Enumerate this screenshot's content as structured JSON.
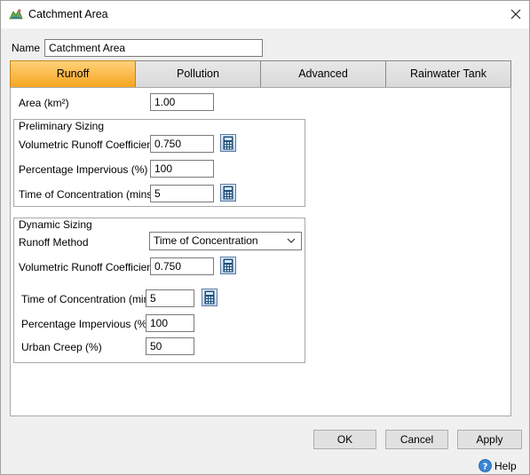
{
  "window": {
    "title": "Catchment Area"
  },
  "name_field": {
    "label": "Name",
    "value": "Catchment Area"
  },
  "tabs": [
    {
      "label": "Runoff",
      "active": true
    },
    {
      "label": "Pollution",
      "active": false
    },
    {
      "label": "Advanced",
      "active": false
    },
    {
      "label": "Rainwater Tank",
      "active": false
    }
  ],
  "runoff": {
    "area": {
      "label": "Area (km²)",
      "value": "1.00"
    },
    "preliminary": {
      "title": "Preliminary Sizing",
      "vrc": {
        "label": "Volumetric Runoff Coefficient",
        "value": "0.750"
      },
      "pct_impervious": {
        "label": "Percentage Impervious (%)",
        "value": "100"
      },
      "toc": {
        "label": "Time of Concentration (mins)",
        "value": "5"
      }
    },
    "dynamic": {
      "title": "Dynamic Sizing",
      "method": {
        "label": "Runoff Method",
        "value": "Time of Concentration"
      },
      "vrc": {
        "label": "Volumetric Runoff Coefficient",
        "value": "0.750"
      },
      "toc": {
        "label": "Time of Concentration (mins)",
        "value": "5"
      },
      "pct_impervious": {
        "label": "Percentage Impervious (%)",
        "value": "100"
      },
      "urban_creep": {
        "label": "Urban Creep (%)",
        "value": "50"
      }
    }
  },
  "buttons": {
    "ok": "OK",
    "cancel": "Cancel",
    "apply": "Apply"
  },
  "help": {
    "label": "Help"
  },
  "colors": {
    "active_tab": "#f6a51f",
    "calc_icon": "#1f4e79"
  },
  "icons": {
    "app": "catchment-app-icon",
    "close": "close-icon",
    "calculator": "calculator-icon",
    "help": "help-icon",
    "dropdown": "chevron-down-icon"
  }
}
